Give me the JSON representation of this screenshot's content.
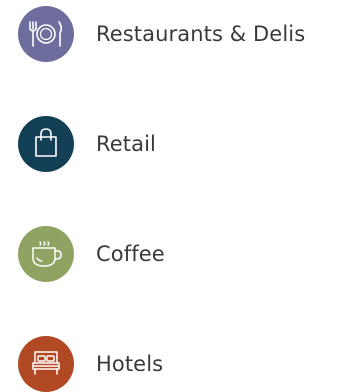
{
  "categories": [
    {
      "label": "Restaurants & Delis",
      "icon": "dining-plate-icon",
      "color": "#6e6e9e"
    },
    {
      "label": "Retail",
      "icon": "shopping-bag-icon",
      "color": "#123f55"
    },
    {
      "label": "Coffee",
      "icon": "coffee-cup-icon",
      "color": "#8fa462"
    },
    {
      "label": "Hotels",
      "icon": "hotel-bed-icon",
      "color": "#b14a24"
    }
  ]
}
